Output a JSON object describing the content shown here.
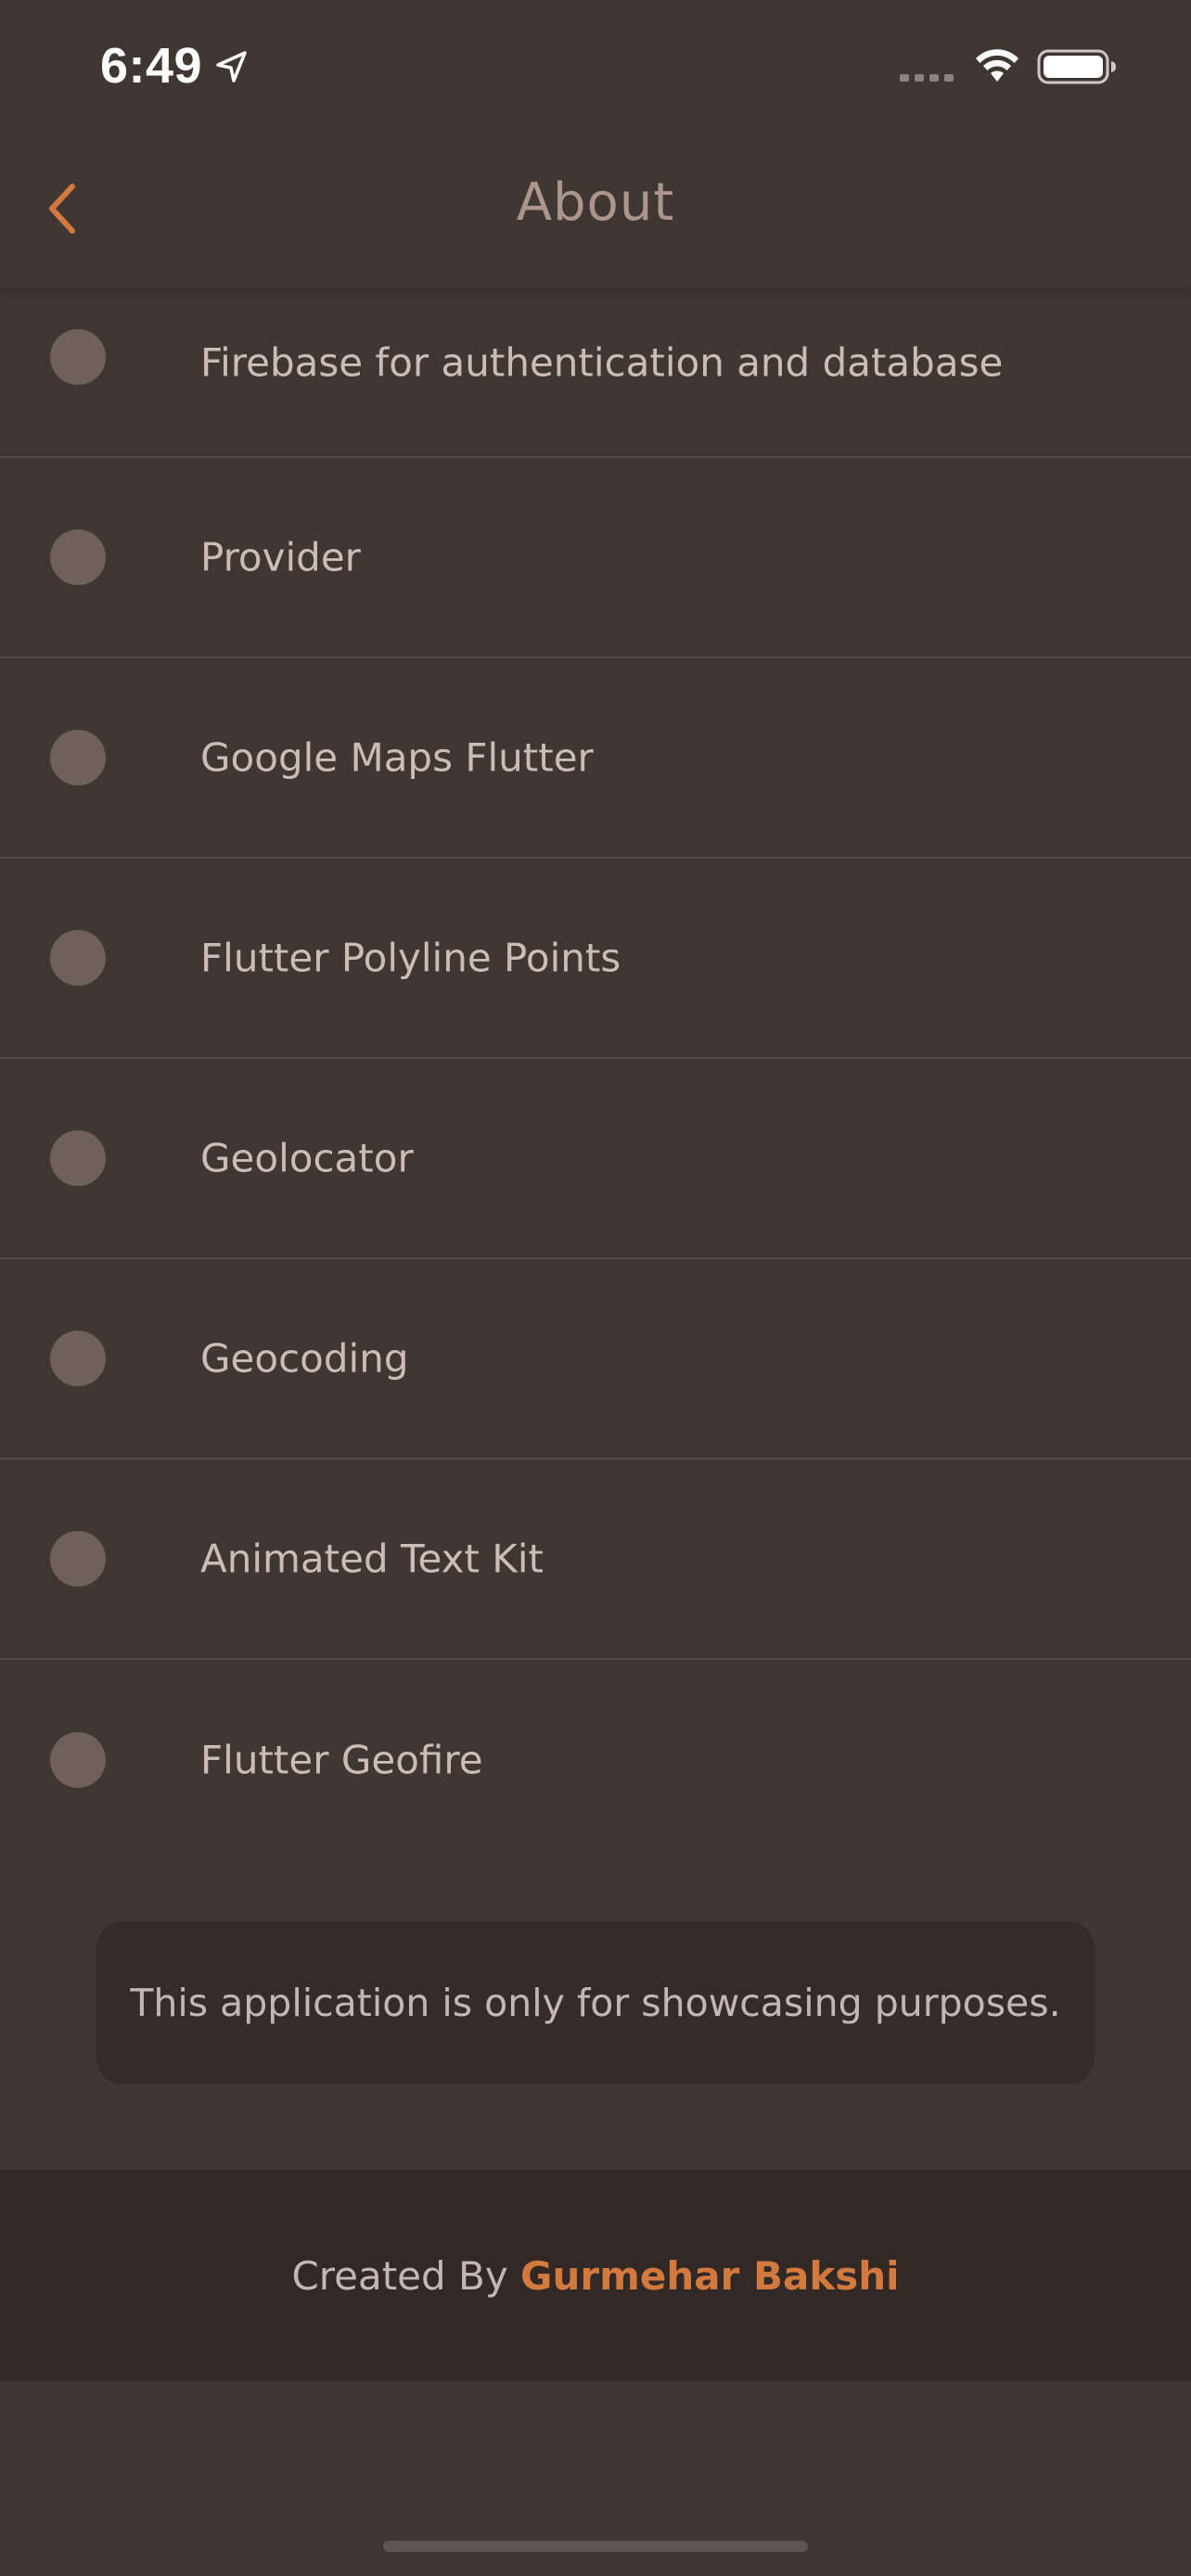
{
  "status_bar": {
    "time": "6:49"
  },
  "app_bar": {
    "title": "About",
    "back_icon": "chevron-left-icon",
    "accent_color": "#d2793f"
  },
  "list": {
    "items": [
      {
        "label": "Firebase for authentication and database"
      },
      {
        "label": "Provider"
      },
      {
        "label": "Google Maps Flutter"
      },
      {
        "label": "Flutter Polyline Points"
      },
      {
        "label": "Geolocator"
      },
      {
        "label": "Geocoding"
      },
      {
        "label": "Animated Text Kit"
      },
      {
        "label": "Flutter Geofire"
      }
    ]
  },
  "notice": {
    "text": "This application is only for showcasing purposes."
  },
  "footer": {
    "prefix": "Created By ",
    "author": "Gurmehar Bakshi"
  }
}
